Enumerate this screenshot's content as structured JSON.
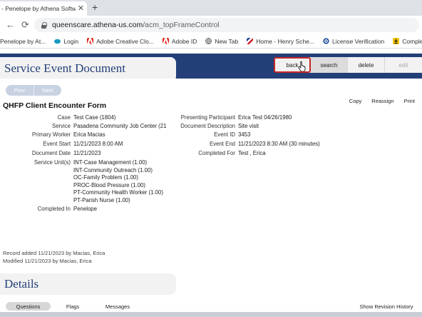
{
  "browser": {
    "tab_title": "- Penelope by Athena Softwa",
    "tab_close_icon": "close-icon",
    "new_tab_icon": "plus-icon",
    "url_host": "queenscare.athena-us.com",
    "url_path": "/acm_topFrameControl",
    "bookmarks": [
      {
        "label": "Penelope by At...",
        "icon": "page-icon",
        "color": "#ffffff"
      },
      {
        "label": "Login",
        "icon": "salesforce-icon",
        "color": "#1798c1"
      },
      {
        "label": "Adobe Creative Clo...",
        "icon": "adobe-icon",
        "color": "#e1251b"
      },
      {
        "label": "Adobe ID",
        "icon": "adobe-icon",
        "color": "#e1251b"
      },
      {
        "label": "New Tab",
        "icon": "globe-icon",
        "color": "#5f6368"
      },
      {
        "label": "Home - Henry Sche...",
        "icon": "henry-schein-icon",
        "color": "#d4212b"
      },
      {
        "label": "License Verification",
        "icon": "seal-icon",
        "color": "#1f4e9c"
      },
      {
        "label": "Completed | D",
        "icon": "download-icon",
        "color": "#f2c400"
      }
    ]
  },
  "header": {
    "title": "Service Event Document",
    "actions": {
      "back": "back",
      "search": "search",
      "delete": "delete",
      "edit": "edit"
    }
  },
  "pager": {
    "prev": "Prev",
    "next": "Next"
  },
  "form": {
    "title": "QHFP Client Encounter Form",
    "links": {
      "copy": "Copy",
      "reassign": "Reassign",
      "print": "Print"
    },
    "left": {
      "case_label": "Case",
      "case_value": "Test  Case (1804)",
      "service_label": "Service",
      "service_value": "Pasadena Community Job Center  (21",
      "worker_label": "Primary Worker",
      "worker_value": "Erica  Macias",
      "start_label": "Event Start",
      "start_value": "11/21/2023 8:00 AM",
      "docdate_label": "Document Date",
      "docdate_value": "11/21/2023",
      "units_label": "Service Unit(s)",
      "units": [
        "INT-Case Management (1.00)",
        "INT-Community Outreach (1.00)",
        "OC-Family Problem (1.00)",
        "PROC-Blood Pressure (1.00)",
        "PT-Community Health Worker (1.00)",
        "PT-Parish Nurse (1.00)"
      ],
      "completed_in_label": "Completed In",
      "completed_in_value": "Penelope"
    },
    "right": {
      "participant_label": "Presenting Participant",
      "participant_value": "Erica  Test  04/26/1980",
      "desc_label": "Document Description",
      "desc_value": "Site visit",
      "eventid_label": "Event ID",
      "eventid_value": "3453",
      "end_label": "Event End",
      "end_value": "11/21/2023 8:30 AM (30 minutes)",
      "completed_for_label": "Completed For",
      "completed_for_value": "Test , Erica"
    },
    "audit": {
      "added": "Record added 11/21/2023 by Macias, Erica",
      "modified": "Modified 11/21/2023 by Macias, Erica"
    }
  },
  "details": {
    "title": "Details",
    "tabs": {
      "questions": "Questions",
      "flags": "Flags",
      "messages": "Messages"
    },
    "revision_link": "Show Revision History"
  }
}
